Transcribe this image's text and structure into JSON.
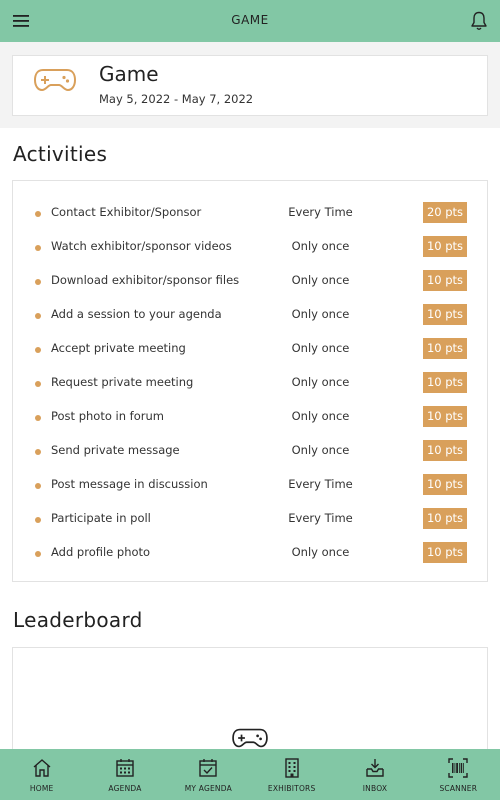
{
  "header": {
    "title": "GAME",
    "menu_icon": "hamburger-menu-icon",
    "notification_icon": "bell-icon"
  },
  "game": {
    "name": "Game",
    "dates": "May 5, 2022 - May 7, 2022",
    "icon": "gamepad-icon"
  },
  "activities": {
    "title": "Activities",
    "items": [
      {
        "label": "Contact Exhibitor/Sponsor",
        "frequency": "Every Time",
        "points": "20 pts"
      },
      {
        "label": "Watch exhibitor/sponsor videos",
        "frequency": "Only once",
        "points": "10 pts"
      },
      {
        "label": "Download exhibitor/sponsor files",
        "frequency": "Only once",
        "points": "10 pts"
      },
      {
        "label": "Add a session to your agenda",
        "frequency": "Only once",
        "points": "10 pts"
      },
      {
        "label": "Accept private meeting",
        "frequency": "Only once",
        "points": "10 pts"
      },
      {
        "label": "Request private meeting",
        "frequency": "Only once",
        "points": "10 pts"
      },
      {
        "label": "Post photo in forum",
        "frequency": "Only once",
        "points": "10 pts"
      },
      {
        "label": "Send private message",
        "frequency": "Only once",
        "points": "10 pts"
      },
      {
        "label": "Post message in discussion",
        "frequency": "Every Time",
        "points": "10 pts"
      },
      {
        "label": "Participate in poll",
        "frequency": "Every Time",
        "points": "10 pts"
      },
      {
        "label": "Add profile photo",
        "frequency": "Only once",
        "points": "10 pts"
      }
    ]
  },
  "leaderboard": {
    "title": "Leaderboard",
    "icon": "gamepad-icon"
  },
  "bottom_nav": {
    "items": [
      {
        "label": "HOME",
        "icon": "home-icon"
      },
      {
        "label": "AGENDA",
        "icon": "calendar-icon"
      },
      {
        "label": "MY AGENDA",
        "icon": "calendar-check-icon"
      },
      {
        "label": "EXHIBITORS",
        "icon": "building-icon"
      },
      {
        "label": "INBOX",
        "icon": "inbox-icon"
      },
      {
        "label": "SCANNER",
        "icon": "barcode-scanner-icon"
      }
    ]
  },
  "colors": {
    "header_bg": "#82c7a5",
    "accent": "#d9a05b",
    "page_bg": "#ffffff",
    "band_bg": "#f3f3f3"
  }
}
